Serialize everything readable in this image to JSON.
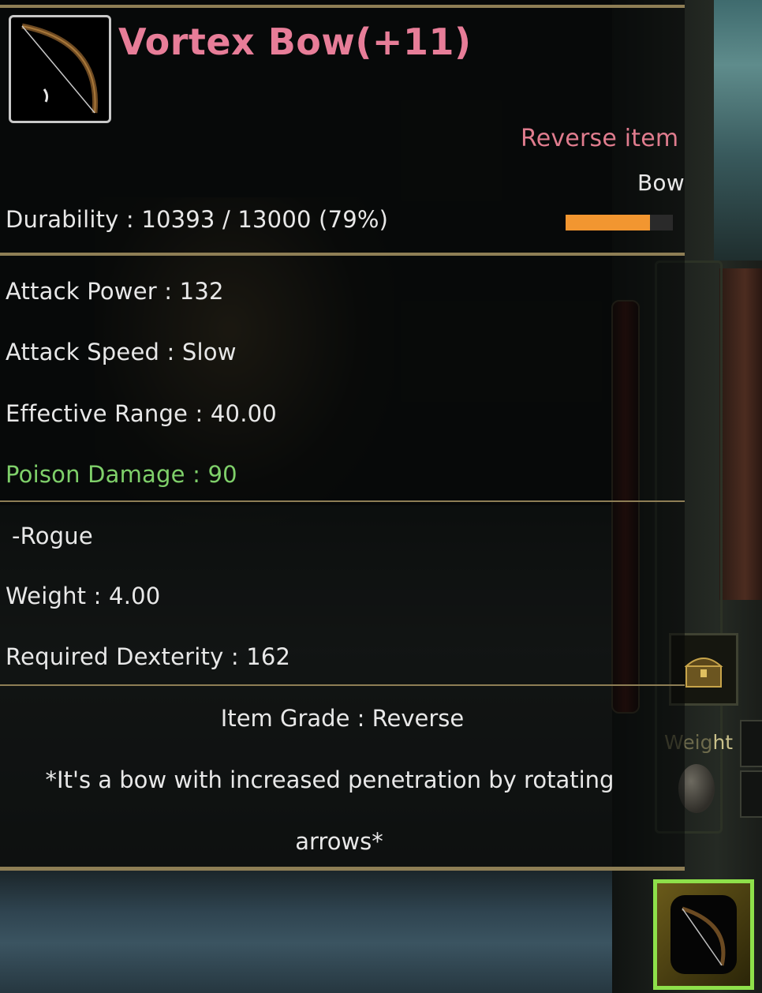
{
  "tooltip": {
    "item_name": "Vortex Bow(+11)",
    "category": "Reverse item",
    "type": "Bow",
    "durability_text": "Durability : 10393 / 13000 (79%)",
    "durability_fraction": 0.79,
    "stats": {
      "attack_power": "Attack Power : 132",
      "attack_speed": "Attack Speed : Slow",
      "effective_range": "Effective Range : 40.00",
      "poison_damage": "Poison Damage : 90"
    },
    "class_restriction": "-Rogue",
    "weight": "Weight : 4.00",
    "required_dexterity": "Required Dexterity : 162",
    "item_grade": "Item Grade : Reverse",
    "description_line1": "*It's a bow with increased penetration by rotating",
    "description_line2": "arrows*"
  },
  "side_ui": {
    "weight_label_dim": "Weig",
    "weight_label_hl": "ht"
  },
  "icons": {
    "item_icon": "bow-icon",
    "chest_icon": "treasure-chest-icon",
    "hotbar_icon": "bow-icon"
  },
  "colors": {
    "name_color": "#e77d98",
    "grade_color": "#e07c8e",
    "poison_color": "#7fd06a",
    "durability_bar": "#f29630",
    "hotbar_border": "#8ee04a"
  }
}
